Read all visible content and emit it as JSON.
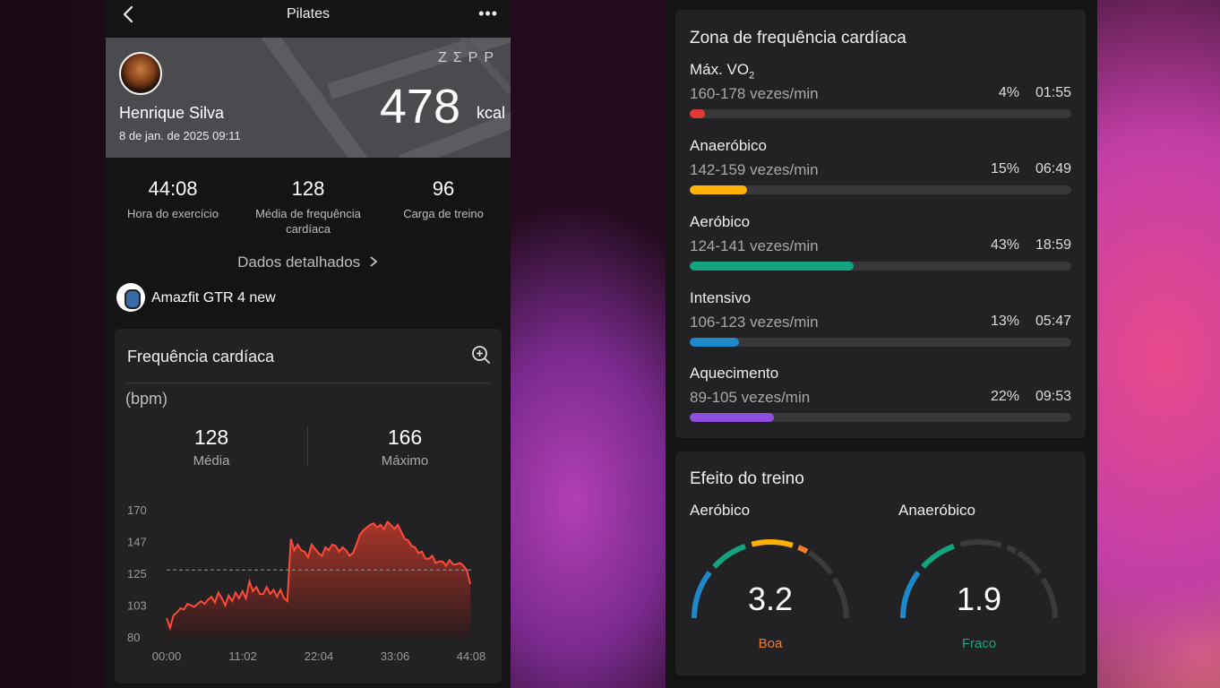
{
  "left": {
    "title": "Pilates",
    "profile": {
      "name": "Henrique Silva",
      "date": "8 de jan. de 2025 09:11",
      "brand": "ZΣPP",
      "calories": "478",
      "calories_unit": "kcal"
    },
    "stats": [
      {
        "value": "44:08",
        "label": "Hora do exercício"
      },
      {
        "value": "128",
        "label": "Média de frequência cardíaca"
      },
      {
        "value": "96",
        "label": "Carga de treino"
      }
    ],
    "detail_link": "Dados detalhados",
    "device": "Amazfit GTR 4 new",
    "hr_card": {
      "title": "Frequência cardíaca",
      "unit": "(bpm)",
      "avg_value": "128",
      "avg_label": "Média",
      "max_value": "166",
      "max_label": "Máximo"
    }
  },
  "chart_data": {
    "type": "area",
    "y_ticks": [
      "170",
      "147",
      "125",
      "103",
      "80"
    ],
    "x_ticks": [
      "00:00",
      "11:02",
      "22:04",
      "33:06",
      "44:08"
    ],
    "ylim": [
      80,
      170
    ],
    "xlim": [
      0,
      44.13
    ],
    "reference_line": 128,
    "x": [
      0,
      0.5,
      1,
      1.5,
      2,
      2.5,
      3,
      3.5,
      4,
      4.5,
      5,
      5.5,
      6,
      6.5,
      7,
      7.5,
      8,
      8.5,
      9,
      9.5,
      10,
      10.5,
      11,
      11.5,
      12,
      12.5,
      13,
      13.5,
      14,
      14.5,
      15,
      15.5,
      16,
      16.5,
      17,
      17.5,
      18,
      18.5,
      19,
      19.5,
      20,
      20.5,
      21,
      21.5,
      22,
      22.5,
      23,
      23.5,
      24,
      24.5,
      25,
      25.5,
      26,
      26.5,
      27,
      27.5,
      28,
      28.5,
      29,
      29.5,
      30,
      30.5,
      31,
      31.5,
      32,
      32.5,
      33,
      33.5,
      34,
      34.5,
      35,
      35.5,
      36,
      36.5,
      37,
      37.5,
      38,
      38.5,
      39,
      39.5,
      40,
      40.5,
      41,
      41.5,
      42,
      42.5,
      43,
      43.5,
      44
    ],
    "values": [
      94,
      87,
      96,
      98,
      101,
      100,
      104,
      103,
      102,
      104,
      106,
      104,
      107,
      109,
      105,
      112,
      108,
      103,
      110,
      106,
      112,
      108,
      113,
      108,
      120,
      113,
      116,
      111,
      111,
      116,
      111,
      114,
      109,
      114,
      108,
      106,
      150,
      142,
      146,
      142,
      141,
      137,
      146,
      143,
      140,
      138,
      144,
      142,
      146,
      145,
      141,
      144,
      142,
      138,
      140,
      146,
      153,
      156,
      158,
      160,
      161,
      158,
      160,
      157,
      162,
      160,
      157,
      160,
      155,
      150,
      149,
      145,
      144,
      140,
      141,
      136,
      136,
      138,
      133,
      134,
      134,
      131,
      135,
      132,
      132,
      133,
      131,
      128,
      118
    ]
  },
  "right": {
    "zones_title": "Zona de frequência cardíaca",
    "zones": [
      {
        "name": "Máx. VO",
        "name_sub": "2",
        "range": "160-178 vezes/min",
        "pct": "4%",
        "time": "01:55",
        "fraction": 0.04,
        "color": "#e53935"
      },
      {
        "name": "Anaeróbico",
        "name_sub": "",
        "range": "142-159 vezes/min",
        "pct": "15%",
        "time": "06:49",
        "fraction": 0.15,
        "color": "#ffb300"
      },
      {
        "name": "Aeróbico",
        "name_sub": "",
        "range": "124-141 vezes/min",
        "pct": "43%",
        "time": "18:59",
        "fraction": 0.43,
        "color": "#14a37f"
      },
      {
        "name": "Intensivo",
        "name_sub": "",
        "range": "106-123 vezes/min",
        "pct": "13%",
        "time": "05:47",
        "fraction": 0.13,
        "color": "#1e88c8"
      },
      {
        "name": "Aquecimento",
        "name_sub": "",
        "range": "89-105 vezes/min",
        "pct": "22%",
        "time": "09:53",
        "fraction": 0.22,
        "color": "#8e4fe0"
      }
    ],
    "effect_title": "Efeito do treino",
    "aerobic": {
      "label": "Aeróbico",
      "value": "3.2",
      "status": "Boa",
      "status_color": "#f07b2a"
    },
    "anaerobic": {
      "label": "Anaeróbico",
      "value": "1.9",
      "status": "Fraco",
      "status_color": "#1aa37f"
    }
  }
}
